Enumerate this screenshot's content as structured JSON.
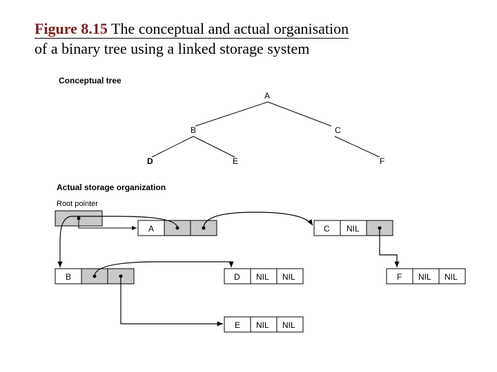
{
  "title": {
    "figure_number": "Figure 8.15",
    "caption": "The conceptual and actual organisation of a binary tree using a linked  storage system"
  },
  "sections": {
    "conceptual_label": "Conceptual tree",
    "actual_label": "Actual storage organization",
    "root_pointer_label": "Root pointer"
  },
  "tree_nodes": {
    "A": "A",
    "B": "B",
    "C": "C",
    "D": "D",
    "E": "E",
    "F": "F"
  },
  "storage_cells": {
    "nil": "NIL",
    "A": "A",
    "B": "B",
    "C": "C",
    "D": "D",
    "E": "E",
    "F": "F"
  }
}
